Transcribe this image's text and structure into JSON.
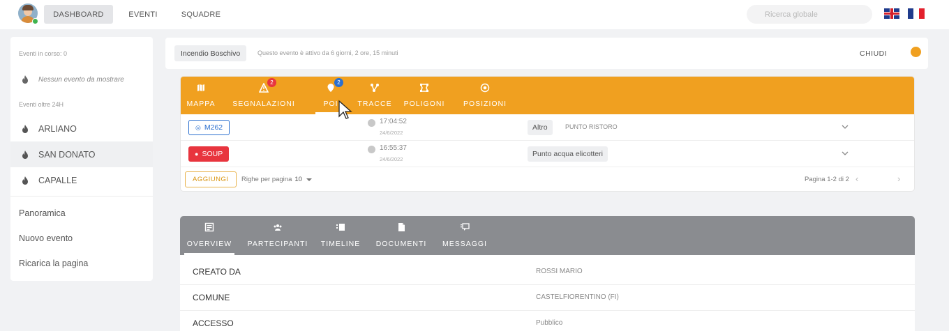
{
  "nav": {
    "dashboard": "DASHBOARD",
    "eventi": "EVENTI",
    "squadre": "SQUADRE",
    "search_placeholder": "Ricerca globale"
  },
  "sidebar": {
    "in_corso_label": "Eventi in corso: 0",
    "empty_label": "Nessun evento da mostrare",
    "oltre_label": "Eventi oltre 24H",
    "events": [
      "ARLIANO",
      "SAN DONATO",
      "CAPALLE"
    ],
    "active_event": "SAN DONATO",
    "links": [
      "Panoramica",
      "Nuovo evento",
      "Ricarica la pagina"
    ]
  },
  "event": {
    "type": "Incendio Boschivo",
    "description": "Questo evento è attivo da 6 giorni, 2 ore, 15 minuti",
    "close_label": "CHIUDI",
    "status_color": "#f0a020"
  },
  "poi_tabs": [
    {
      "label": "MAPPA",
      "icon": "map-icon"
    },
    {
      "label": "SEGNALAZIONI",
      "icon": "warning-icon",
      "badge": "2",
      "badge_color": "#e8353e"
    },
    {
      "label": "POI",
      "icon": "pin-icon",
      "badge": "2",
      "badge_color": "#2a6fcf",
      "active": true
    },
    {
      "label": "TRACCE",
      "icon": "route-icon"
    },
    {
      "label": "POLIGONI",
      "icon": "polygon-icon"
    },
    {
      "label": "POSIZIONI",
      "icon": "target-icon"
    }
  ],
  "poi_rows": [
    {
      "code": "M262",
      "time": "17:04:52",
      "date": "24/6/2022",
      "category": "Altro",
      "subcategory": "PUNTO RISTORO"
    },
    {
      "code": "SOUP",
      "time": "16:55:37",
      "date": "24/6/2022",
      "category": "Punto acqua elicotteri",
      "subcategory": ""
    }
  ],
  "poi_footer": {
    "add_label": "AGGIUNGI",
    "rows_per_page_label": "Righe per pagina",
    "rows_per_page": "10",
    "pagination": "Pagina 1-2 di 2"
  },
  "overview_tabs": [
    {
      "label": "OVERVIEW",
      "icon": "overview-icon",
      "active": true
    },
    {
      "label": "PARTECIPANTI",
      "icon": "people-icon"
    },
    {
      "label": "TIMELINE",
      "icon": "timeline-icon"
    },
    {
      "label": "DOCUMENTI",
      "icon": "document-icon"
    },
    {
      "label": "MESSAGGI",
      "icon": "message-icon"
    }
  ],
  "overview": {
    "rows": [
      {
        "label": "CREATO DA",
        "value": "ROSSI MARIO"
      },
      {
        "label": "COMUNE",
        "value": "CASTELFIORENTINO (FI)"
      },
      {
        "label": "ACCESSO",
        "value": "Pubblico"
      }
    ]
  },
  "colors": {
    "accent_orange": "#f0a020",
    "overview_grey": "#8a8c90",
    "badge_red": "#e8353e",
    "badge_blue": "#2a6fcf"
  }
}
